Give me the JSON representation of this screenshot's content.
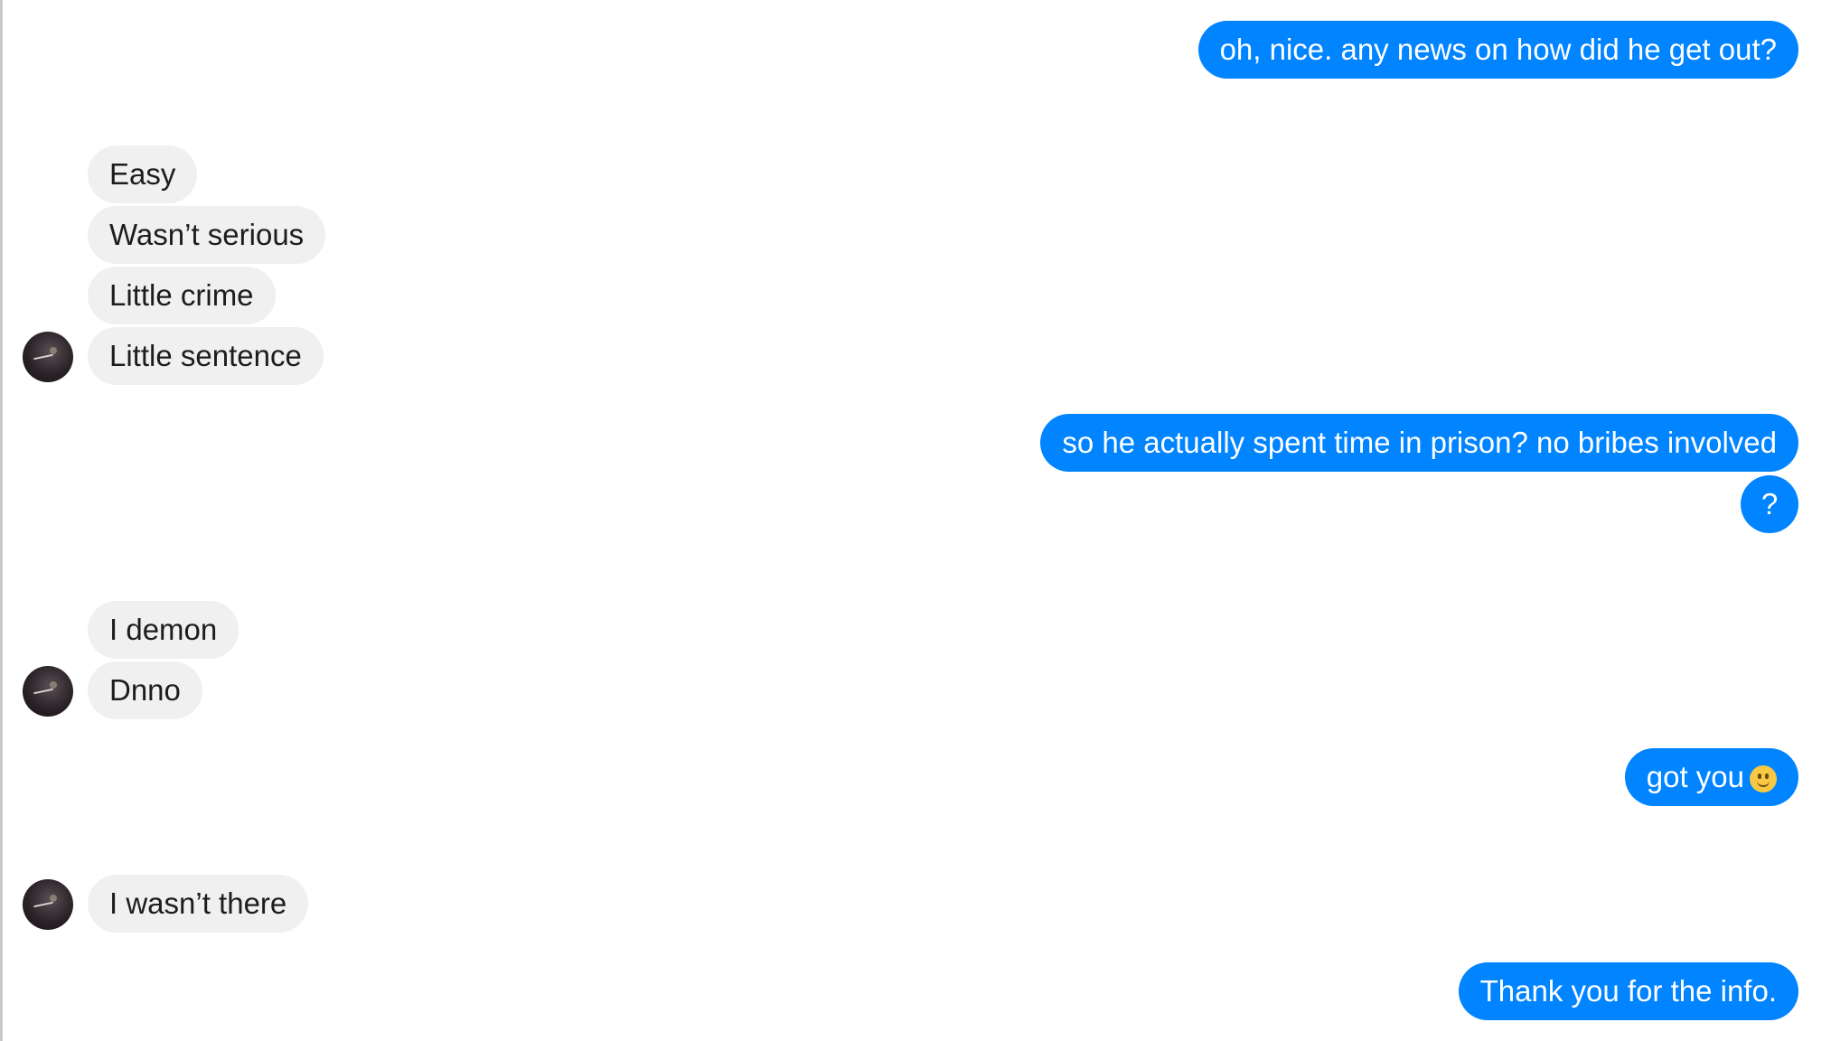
{
  "conversation": {
    "messages": [
      {
        "side": "out",
        "text": "oh, nice. any news on how did he get out?"
      },
      {
        "side": "in",
        "text": "Easy"
      },
      {
        "side": "in",
        "text": "Wasn’t serious"
      },
      {
        "side": "in",
        "text": "Little crime"
      },
      {
        "side": "in",
        "text": "Little sentence"
      },
      {
        "side": "out",
        "text": "so he actually spent time in prison? no bribes involved"
      },
      {
        "side": "out",
        "text": "?"
      },
      {
        "side": "in",
        "text": "I demon"
      },
      {
        "side": "in",
        "text": "Dnno"
      },
      {
        "side": "out",
        "text": "got you",
        "emoji": "slightly-smiling-face-icon"
      },
      {
        "side": "in",
        "text": "I wasn’t there"
      },
      {
        "side": "out",
        "text": "Thank you for the info."
      }
    ]
  },
  "colors": {
    "outgoing_bubble": "#0084ff",
    "incoming_bubble": "#f1f0f0",
    "outgoing_text": "#ffffff",
    "incoming_text": "#1d1d1d"
  }
}
